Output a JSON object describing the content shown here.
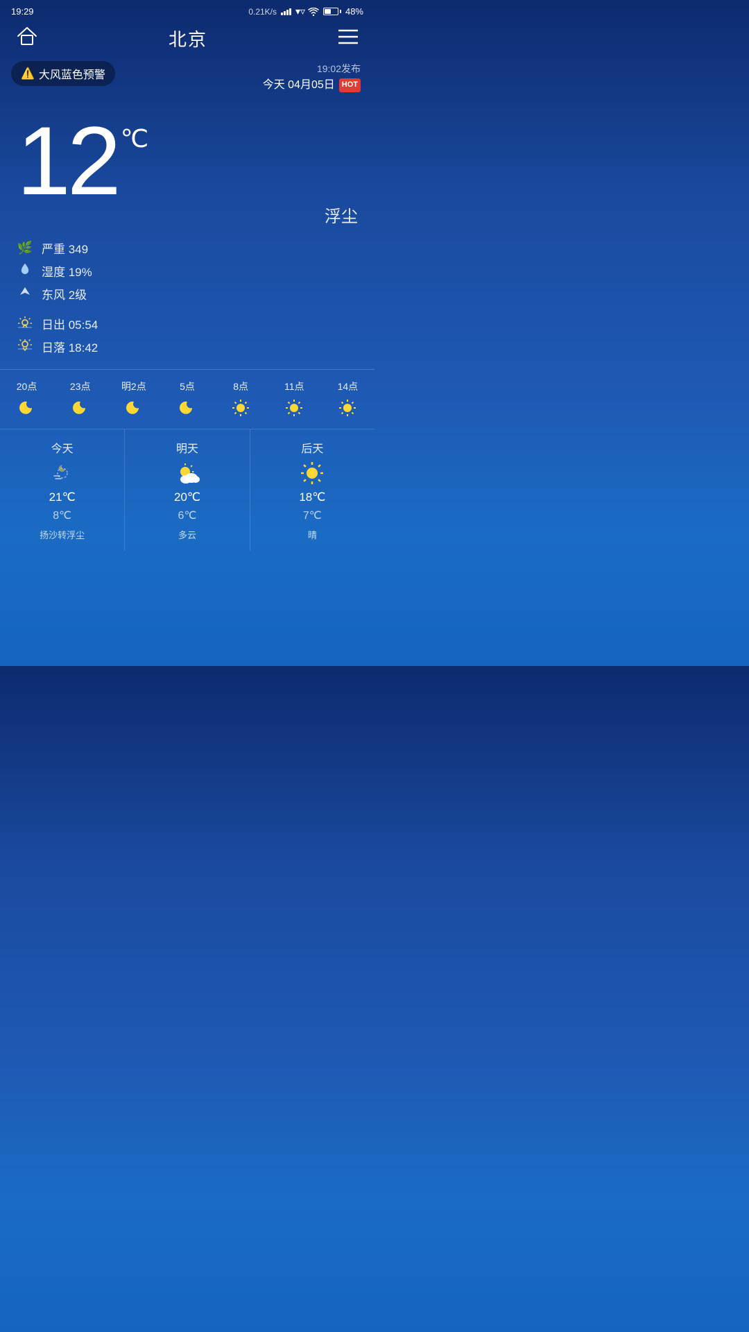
{
  "statusBar": {
    "time": "19:29",
    "network": "0.21K/s",
    "battery": "48%",
    "batteryPercent": 48
  },
  "header": {
    "city": "北京",
    "homeLabel": "home",
    "menuLabel": "menu"
  },
  "alert": {
    "text": "大风蓝色预警",
    "publishTime": "19:02发布",
    "date": "今天 04月05日",
    "hotBadge": "HOT"
  },
  "weather": {
    "temperature": "12",
    "unit": "℃",
    "description": "浮尘"
  },
  "details": {
    "aqi": "严重 349",
    "humidity": "湿度 19%",
    "wind": "东风 2级"
  },
  "sun": {
    "sunrise": "日出  05:54",
    "sunset": "日落  18:42"
  },
  "hourly": [
    {
      "label": "20点",
      "icon": "moon"
    },
    {
      "label": "23点",
      "icon": "moon"
    },
    {
      "label": "明2点",
      "icon": "moon"
    },
    {
      "label": "5点",
      "icon": "moon"
    },
    {
      "label": "8点",
      "icon": "sun"
    },
    {
      "label": "11点",
      "icon": "sun"
    },
    {
      "label": "14点",
      "icon": "sun"
    }
  ],
  "daily": [
    {
      "label": "今天",
      "icon": "night-haze",
      "high": "21℃",
      "low": "8℃",
      "desc": "扬沙转浮尘"
    },
    {
      "label": "明天",
      "icon": "partly-cloudy",
      "high": "20℃",
      "low": "6℃",
      "desc": "多云"
    },
    {
      "label": "后天",
      "icon": "sunny",
      "high": "18℃",
      "low": "7℃",
      "desc": "晴"
    }
  ]
}
